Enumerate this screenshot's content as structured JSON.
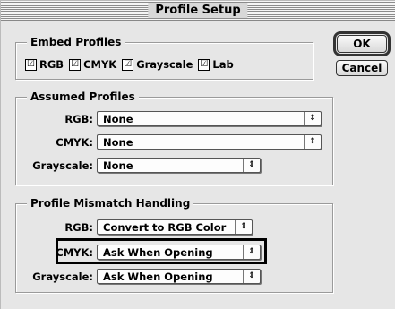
{
  "window": {
    "title": "Profile Setup"
  },
  "embed": {
    "label": "Embed Profiles",
    "items": [
      {
        "label": "RGB",
        "check": "☑"
      },
      {
        "label": "CMYK",
        "check": "☑"
      },
      {
        "label": "Grayscale",
        "check": "☑"
      },
      {
        "label": "Lab",
        "check": "☑"
      }
    ]
  },
  "assumed": {
    "label": "Assumed Profiles",
    "rgb": {
      "label": "RGB:",
      "value": "None"
    },
    "cmyk": {
      "label": "CMYK:",
      "value": "None"
    },
    "grayscale": {
      "label": "Grayscale:",
      "value": "None"
    }
  },
  "mismatch": {
    "label": "Profile Mismatch Handling",
    "rgb": {
      "label": "RGB:",
      "value": "Convert to RGB Color"
    },
    "cmyk": {
      "label": "CMYK:",
      "value": "Ask When Opening"
    },
    "grayscale": {
      "label": "Grayscale:",
      "value": "Ask When Opening"
    }
  },
  "buttons": {
    "ok": "OK",
    "cancel": "Cancel"
  },
  "arrow_glyph": "⇕"
}
